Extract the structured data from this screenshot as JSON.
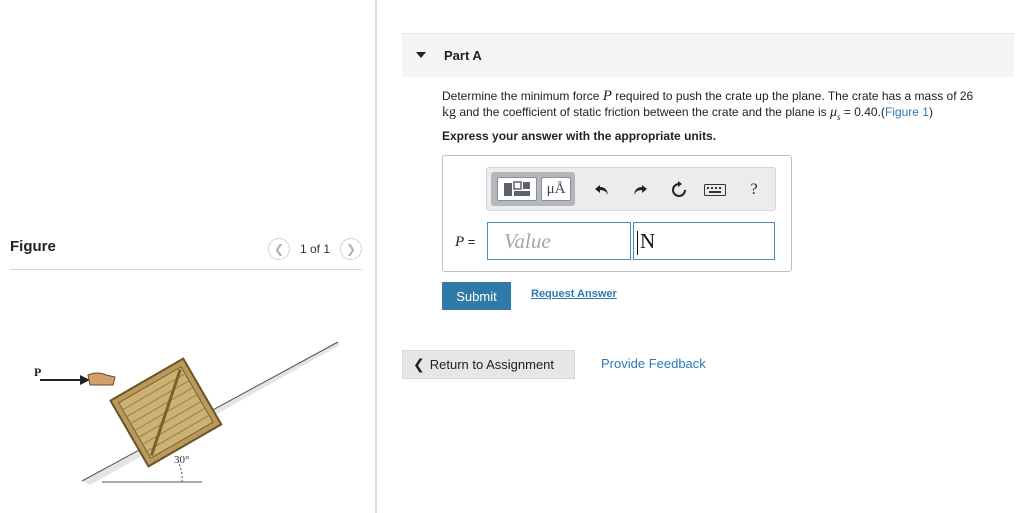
{
  "figure_panel": {
    "title": "Figure",
    "pager_text": "1 of 1",
    "diagram": {
      "force_label": "P",
      "angle_label": "30°"
    }
  },
  "part": {
    "title": "Part A"
  },
  "question": {
    "text_1": "Determine the minimum force ",
    "var_p": "P",
    "text_2": " required to push the crate up the plane. The crate has a mass of 26",
    "unit_kg": "kg",
    "text_3": " and the coefficient of static friction between the crate and the plane is ",
    "mu_symbol": "μ",
    "mu_sub": "s",
    "text_4": " = 0.40.(",
    "figure_link": "Figure 1",
    "text_5": ")",
    "instruction": "Express your answer with the appropriate units."
  },
  "answer": {
    "toolbar": {
      "units_button": "μÅ",
      "undo_icon": "undo-icon",
      "redo_icon": "redo-icon",
      "reset_icon": "reset-icon",
      "keyboard_icon": "keyboard-icon",
      "help_label": "?"
    },
    "variable": "P",
    "equals": " =",
    "value_placeholder": "Value",
    "unit_value": "N"
  },
  "actions": {
    "submit_label": "Submit",
    "request_answer_label": "Request Answer",
    "return_label": "Return to Assignment",
    "feedback_label": "Provide Feedback"
  },
  "colors": {
    "link": "#2a79b8",
    "submit_bg": "#2f7aa8",
    "input_border": "#4a8ac7"
  }
}
